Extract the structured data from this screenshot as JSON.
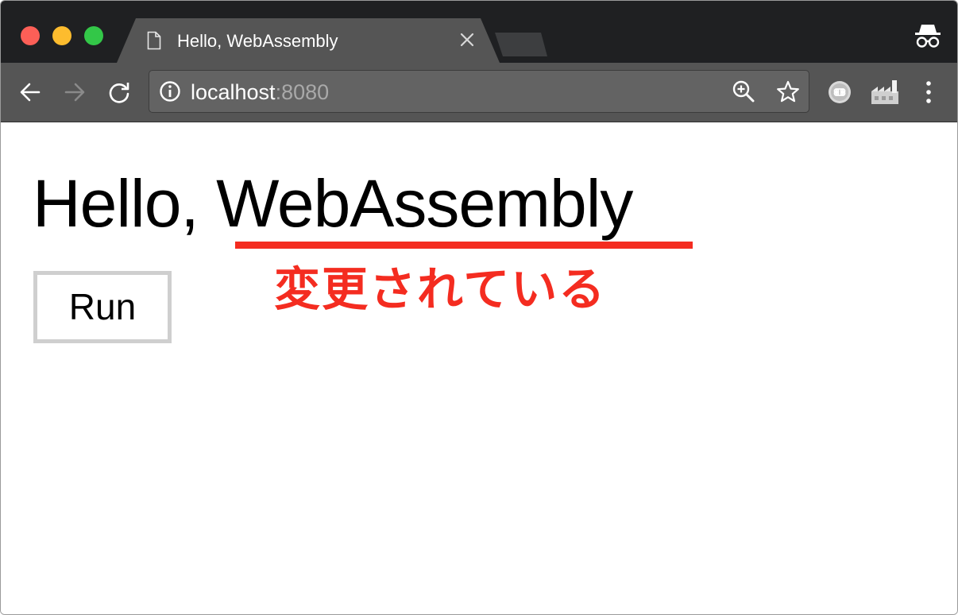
{
  "window": {
    "controls": [
      "close",
      "minimize",
      "maximize"
    ],
    "colors": {
      "close": "#fc5f57",
      "minimize": "#fdbc2e",
      "maximize": "#33c748",
      "chrome_dark": "#1f2022",
      "toolbar": "#555555",
      "accent_red": "#f42c20"
    }
  },
  "tab": {
    "title": "Hello, WebAssembly",
    "icon": "document-icon",
    "close_icon": "close-icon"
  },
  "toolbar": {
    "back_icon": "arrow-left-icon",
    "forward_icon": "arrow-right-icon",
    "reload_icon": "reload-icon",
    "url_host": "localhost",
    "url_port": ":8080",
    "site_info_icon": "info-icon",
    "zoom_icon": "zoom-in-icon",
    "bookmark_icon": "star-icon",
    "extensions": [
      "command-extension-icon",
      "factory-extension-icon"
    ],
    "menu_icon": "more-vertical-icon",
    "incognito_icon": "incognito-icon"
  },
  "page": {
    "heading": "Hello, WebAssembly",
    "run_button": "Run",
    "annotation": "変更されている"
  }
}
